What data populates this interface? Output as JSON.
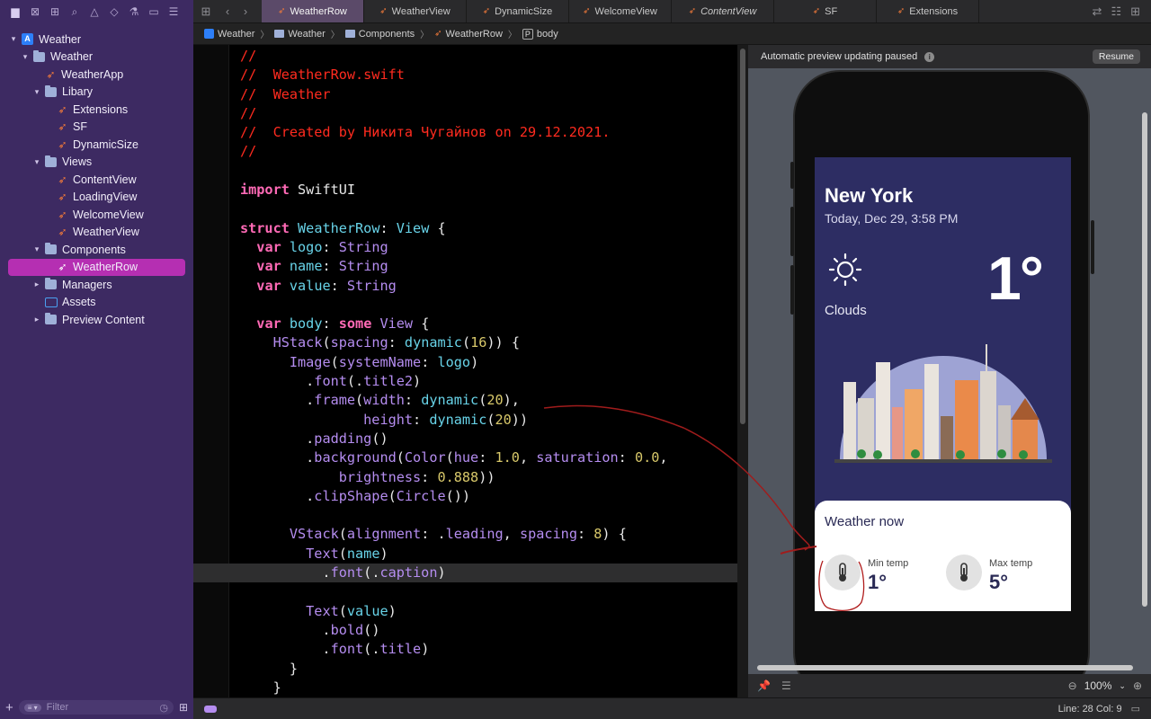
{
  "navigator": {
    "toolbar_icons": [
      "folder-icon",
      "source-control-icon",
      "hierarchy-icon",
      "search-icon",
      "warning-icon",
      "test-icon",
      "debug-icon",
      "breakpoint-icon",
      "report-icon"
    ],
    "tree": [
      {
        "label": "Weather",
        "kind": "project",
        "indent": 0,
        "disclosure": "open"
      },
      {
        "label": "Weather",
        "kind": "folder",
        "indent": 1,
        "disclosure": "open"
      },
      {
        "label": "WeatherApp",
        "kind": "swift",
        "indent": 2,
        "disclosure": ""
      },
      {
        "label": "Libary",
        "kind": "folder",
        "indent": 2,
        "disclosure": "open"
      },
      {
        "label": "Extensions",
        "kind": "swift",
        "indent": 3,
        "disclosure": ""
      },
      {
        "label": "SF",
        "kind": "swift",
        "indent": 3,
        "disclosure": ""
      },
      {
        "label": "DynamicSize",
        "kind": "swift",
        "indent": 3,
        "disclosure": ""
      },
      {
        "label": "Views",
        "kind": "folder",
        "indent": 2,
        "disclosure": "open"
      },
      {
        "label": "ContentView",
        "kind": "swift",
        "indent": 3,
        "disclosure": ""
      },
      {
        "label": "LoadingView",
        "kind": "swift",
        "indent": 3,
        "disclosure": ""
      },
      {
        "label": "WelcomeView",
        "kind": "swift",
        "indent": 3,
        "disclosure": ""
      },
      {
        "label": "WeatherView",
        "kind": "swift",
        "indent": 3,
        "disclosure": ""
      },
      {
        "label": "Components",
        "kind": "folder",
        "indent": 2,
        "disclosure": "open"
      },
      {
        "label": "WeatherRow",
        "kind": "swift",
        "indent": 3,
        "disclosure": "",
        "selected": true
      },
      {
        "label": "Managers",
        "kind": "folder",
        "indent": 2,
        "disclosure": "closed"
      },
      {
        "label": "Assets",
        "kind": "assets",
        "indent": 2,
        "disclosure": ""
      },
      {
        "label": "Preview Content",
        "kind": "folder",
        "indent": 2,
        "disclosure": "closed"
      }
    ],
    "filter_placeholder": "Filter"
  },
  "tabs": [
    {
      "label": "WeatherRow",
      "active": true
    },
    {
      "label": "WeatherView"
    },
    {
      "label": "DynamicSize"
    },
    {
      "label": "WelcomeView"
    },
    {
      "label": "ContentView",
      "italic": true
    },
    {
      "label": "SF"
    },
    {
      "label": "Extensions"
    }
  ],
  "breadcrumb": [
    "Weather",
    "Weather",
    "Components",
    "WeatherRow",
    "body"
  ],
  "code_lines": [
    [
      [
        "c-cm",
        "//"
      ]
    ],
    [
      [
        "c-cm",
        "//  WeatherRow.swift"
      ]
    ],
    [
      [
        "c-cm",
        "//  Weather"
      ]
    ],
    [
      [
        "c-cm",
        "//"
      ]
    ],
    [
      [
        "c-cm",
        "//  Created by Никита Чугайнов on 29.12.2021."
      ]
    ],
    [
      [
        "c-cm",
        "//"
      ]
    ],
    [],
    [
      [
        "c-kw",
        "import"
      ],
      [
        "c-pl",
        " SwiftUI"
      ]
    ],
    [],
    [
      [
        "c-kw",
        "struct"
      ],
      [
        "c-pl",
        " "
      ],
      [
        "c-ty",
        "WeatherRow"
      ],
      [
        "c-pl",
        ": "
      ],
      [
        "c-ty",
        "View"
      ],
      [
        "c-pl",
        " {"
      ]
    ],
    [
      [
        "c-pl",
        "  "
      ],
      [
        "c-kw",
        "var"
      ],
      [
        "c-pl",
        " "
      ],
      [
        "c-ty",
        "logo"
      ],
      [
        "c-pl",
        ": "
      ],
      [
        "c-fn",
        "String"
      ]
    ],
    [
      [
        "c-pl",
        "  "
      ],
      [
        "c-kw",
        "var"
      ],
      [
        "c-pl",
        " "
      ],
      [
        "c-ty",
        "name"
      ],
      [
        "c-pl",
        ": "
      ],
      [
        "c-fn",
        "String"
      ]
    ],
    [
      [
        "c-pl",
        "  "
      ],
      [
        "c-kw",
        "var"
      ],
      [
        "c-pl",
        " "
      ],
      [
        "c-ty",
        "value"
      ],
      [
        "c-pl",
        ": "
      ],
      [
        "c-fn",
        "String"
      ]
    ],
    [],
    [
      [
        "c-pl",
        "  "
      ],
      [
        "c-kw",
        "var"
      ],
      [
        "c-pl",
        " "
      ],
      [
        "c-ty",
        "body"
      ],
      [
        "c-pl",
        ": "
      ],
      [
        "c-kw",
        "some"
      ],
      [
        "c-pl",
        " "
      ],
      [
        "c-fn",
        "View"
      ],
      [
        "c-pl",
        " {"
      ]
    ],
    [
      [
        "c-pl",
        "    "
      ],
      [
        "c-fn",
        "HStack"
      ],
      [
        "c-pl",
        "("
      ],
      [
        "c-fn",
        "spacing"
      ],
      [
        "c-pl",
        ": "
      ],
      [
        "c-ty",
        "dynamic"
      ],
      [
        "c-pl",
        "("
      ],
      [
        "c-nm",
        "16"
      ],
      [
        "c-pl",
        ")) {"
      ]
    ],
    [
      [
        "c-pl",
        "      "
      ],
      [
        "c-fn",
        "Image"
      ],
      [
        "c-pl",
        "("
      ],
      [
        "c-fn",
        "systemName"
      ],
      [
        "c-pl",
        ": "
      ],
      [
        "c-ty",
        "logo"
      ],
      [
        "c-pl",
        ")"
      ]
    ],
    [
      [
        "c-pl",
        "        ."
      ],
      [
        "c-fn",
        "font"
      ],
      [
        "c-pl",
        "(."
      ],
      [
        "c-fn",
        "title2"
      ],
      [
        "c-pl",
        ")"
      ]
    ],
    [
      [
        "c-pl",
        "        ."
      ],
      [
        "c-fn",
        "frame"
      ],
      [
        "c-pl",
        "("
      ],
      [
        "c-fn",
        "width"
      ],
      [
        "c-pl",
        ": "
      ],
      [
        "c-ty",
        "dynamic"
      ],
      [
        "c-pl",
        "("
      ],
      [
        "c-nm",
        "20"
      ],
      [
        "c-pl",
        "),"
      ]
    ],
    [
      [
        "c-pl",
        "               "
      ],
      [
        "c-fn",
        "height"
      ],
      [
        "c-pl",
        ": "
      ],
      [
        "c-ty",
        "dynamic"
      ],
      [
        "c-pl",
        "("
      ],
      [
        "c-nm",
        "20"
      ],
      [
        "c-pl",
        "))"
      ]
    ],
    [
      [
        "c-pl",
        "        ."
      ],
      [
        "c-fn",
        "padding"
      ],
      [
        "c-pl",
        "()"
      ]
    ],
    [
      [
        "c-pl",
        "        ."
      ],
      [
        "c-fn",
        "background"
      ],
      [
        "c-pl",
        "("
      ],
      [
        "c-fn",
        "Color"
      ],
      [
        "c-pl",
        "("
      ],
      [
        "c-fn",
        "hue"
      ],
      [
        "c-pl",
        ": "
      ],
      [
        "c-nm",
        "1.0"
      ],
      [
        "c-pl",
        ", "
      ],
      [
        "c-fn",
        "saturation"
      ],
      [
        "c-pl",
        ": "
      ],
      [
        "c-nm",
        "0.0"
      ],
      [
        "c-pl",
        ","
      ]
    ],
    [
      [
        "c-pl",
        "            "
      ],
      [
        "c-fn",
        "brightness"
      ],
      [
        "c-pl",
        ": "
      ],
      [
        "c-nm",
        "0.888"
      ],
      [
        "c-pl",
        "))"
      ]
    ],
    [
      [
        "c-pl",
        "        ."
      ],
      [
        "c-fn",
        "clipShape"
      ],
      [
        "c-pl",
        "("
      ],
      [
        "c-fn",
        "Circle"
      ],
      [
        "c-pl",
        "())"
      ]
    ],
    [],
    [
      [
        "c-pl",
        "      "
      ],
      [
        "c-fn",
        "VStack"
      ],
      [
        "c-pl",
        "("
      ],
      [
        "c-fn",
        "alignment"
      ],
      [
        "c-pl",
        ": ."
      ],
      [
        "c-fn",
        "leading"
      ],
      [
        "c-pl",
        ", "
      ],
      [
        "c-fn",
        "spacing"
      ],
      [
        "c-pl",
        ": "
      ],
      [
        "c-nm",
        "8"
      ],
      [
        "c-pl",
        ") {"
      ]
    ],
    [
      [
        "c-pl",
        "        "
      ],
      [
        "c-fn",
        "Text"
      ],
      [
        "c-pl",
        "("
      ],
      [
        "c-ty",
        "name"
      ],
      [
        "c-pl",
        ")"
      ]
    ],
    [
      [
        "c-pl",
        "          ."
      ],
      [
        "c-fn",
        "font"
      ],
      [
        "c-pl",
        "(."
      ],
      [
        "c-fn",
        "caption"
      ],
      [
        "c-pl",
        ")"
      ]
    ],
    [],
    [
      [
        "c-pl",
        "        "
      ],
      [
        "c-fn",
        "Text"
      ],
      [
        "c-pl",
        "("
      ],
      [
        "c-ty",
        "value"
      ],
      [
        "c-pl",
        ")"
      ]
    ],
    [
      [
        "c-pl",
        "          ."
      ],
      [
        "c-fn",
        "bold"
      ],
      [
        "c-pl",
        "()"
      ]
    ],
    [
      [
        "c-pl",
        "          ."
      ],
      [
        "c-fn",
        "font"
      ],
      [
        "c-pl",
        "(."
      ],
      [
        "c-fn",
        "title"
      ],
      [
        "c-pl",
        ")"
      ]
    ],
    [
      [
        "c-pl",
        "      }"
      ]
    ],
    [
      [
        "c-pl",
        "    }"
      ]
    ]
  ],
  "highlighted_line": 28,
  "canvas": {
    "banner": "Automatic preview updating paused",
    "resume_label": "Resume",
    "zoom": "100%"
  },
  "preview": {
    "city": "New York",
    "date": "Today, Dec 29, 3:58 PM",
    "condition": "Clouds",
    "temperature": "1°",
    "card_title": "Weather now",
    "rows": [
      {
        "name": "Min temp",
        "value": "1°",
        "icon": "thermometer-icon"
      },
      {
        "name": "Max temp",
        "value": "5°",
        "icon": "thermometer-icon"
      }
    ]
  },
  "status": {
    "position": "Line: 28  Col: 9"
  },
  "colors": {
    "navigator_bg": "#3d2a62",
    "selection": "#b52fb2",
    "preview_bg": "#2d2d63",
    "comment": "#ff2b1f",
    "keyword": "#ff6ab6"
  }
}
